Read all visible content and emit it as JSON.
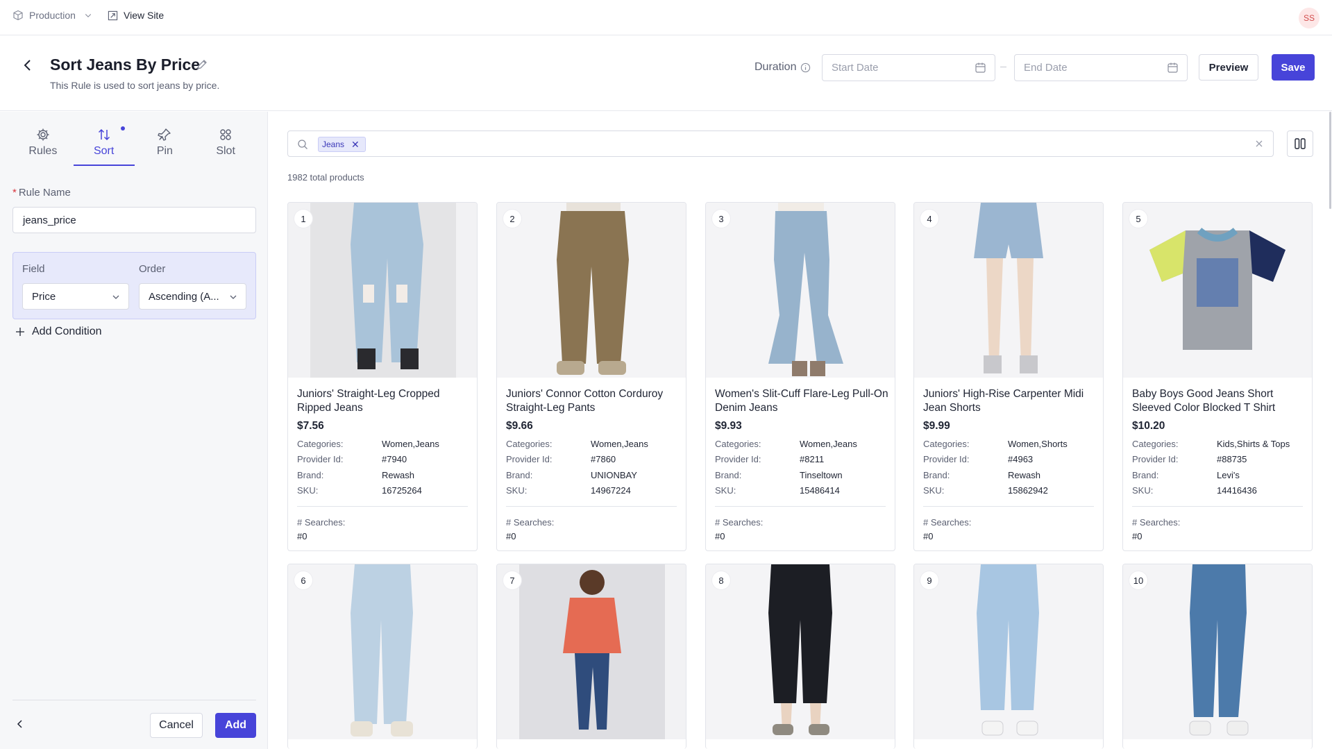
{
  "topbar": {
    "environment": "Production",
    "view_site": "View Site",
    "avatar_initials": "SS"
  },
  "header": {
    "title": "Sort Jeans By Price",
    "subtitle": "This Rule is used to sort jeans by price.",
    "duration_label": "Duration",
    "start_date_placeholder": "Start Date",
    "end_date_placeholder": "End Date",
    "preview_label": "Preview",
    "save_label": "Save"
  },
  "sidebar": {
    "tabs": [
      {
        "label": "Rules",
        "icon": "gear-icon"
      },
      {
        "label": "Sort",
        "icon": "sort-arrows-icon"
      },
      {
        "label": "Pin",
        "icon": "pin-icon"
      },
      {
        "label": "Slot",
        "icon": "grid-icon"
      }
    ],
    "active_tab": "Sort",
    "rule_name_label": "Rule Name",
    "rule_name_value": "jeans_price",
    "field_label": "Field",
    "field_value": "Price",
    "order_label": "Order",
    "order_value": "Ascending (A...",
    "add_condition_label": "Add Condition",
    "cancel_label": "Cancel",
    "add_label": "Add"
  },
  "search": {
    "chip": "Jeans",
    "total_text": "1982 total products"
  },
  "labels": {
    "categories": "Categories:",
    "provider_id": "Provider Id:",
    "brand": "Brand:",
    "sku": "SKU:",
    "searches": "# Searches:"
  },
  "products": [
    {
      "rank": "1",
      "name": "Juniors' Straight-Leg Cropped Ripped Jeans",
      "price": "$7.56",
      "categories": "Women,Jeans",
      "provider_id": "#7940",
      "brand": "Rewash",
      "sku": "16725264",
      "searches": "#0"
    },
    {
      "rank": "2",
      "name": "Juniors' Connor Cotton Corduroy Straight-Leg Pants",
      "price": "$9.66",
      "categories": "Women,Jeans",
      "provider_id": "#7860",
      "brand": "UNIONBAY",
      "sku": "14967224",
      "searches": "#0"
    },
    {
      "rank": "3",
      "name": "Women's Slit-Cuff Flare-Leg Pull-On Denim Jeans",
      "price": "$9.93",
      "categories": "Women,Jeans",
      "provider_id": "#8211",
      "brand": "Tinseltown",
      "sku": "15486414",
      "searches": "#0"
    },
    {
      "rank": "4",
      "name": "Juniors' High-Rise Carpenter Midi Jean Shorts",
      "price": "$9.99",
      "categories": "Women,Shorts",
      "provider_id": "#4963",
      "brand": "Rewash",
      "sku": "15862942",
      "searches": "#0"
    },
    {
      "rank": "5",
      "name": "Baby Boys Good Jeans Short Sleeved Color Blocked T Shirt",
      "price": "$10.20",
      "categories": "Kids,Shirts & Tops",
      "provider_id": "#88735",
      "brand": "Levi's",
      "sku": "14416436",
      "searches": "#0"
    },
    {
      "rank": "6"
    },
    {
      "rank": "7"
    },
    {
      "rank": "8"
    },
    {
      "rank": "9"
    },
    {
      "rank": "10"
    }
  ],
  "colors": {
    "accent": "#4744d9",
    "sidebar_bg": "#f6f7f9",
    "condition_bg": "#e7e9fb"
  }
}
